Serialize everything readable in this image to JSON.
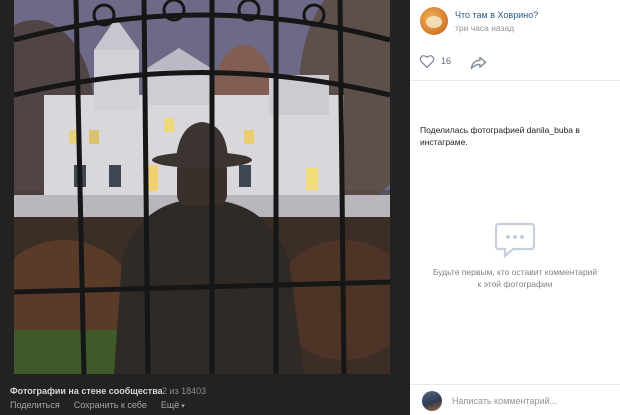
{
  "viewer": {
    "album_title": "Фотографии на стене сообщества",
    "counter": "2 из 18403",
    "actions": {
      "share": "Поделиться",
      "save": "Сохранить к себе",
      "more": "Ещё"
    }
  },
  "post": {
    "community_name": "Что там в Ховрино?",
    "time": "три часа назад",
    "likes_count": "16",
    "description": "Поделилась фотографией danila_buba в инстаграме."
  },
  "comments": {
    "empty_text": "Будьте первым, кто оставит комментарий к этой фотографии",
    "input_placeholder": "Написать комментарий..."
  },
  "colors": {
    "link": "#2a5885",
    "muted": "#939393",
    "icon": "#828a99",
    "viewer_bg": "#222222"
  },
  "icons": {
    "like": "heart-icon",
    "share": "share-arrow-icon",
    "empty": "comment-bubble-icon",
    "more": "chevron-down-icon"
  }
}
